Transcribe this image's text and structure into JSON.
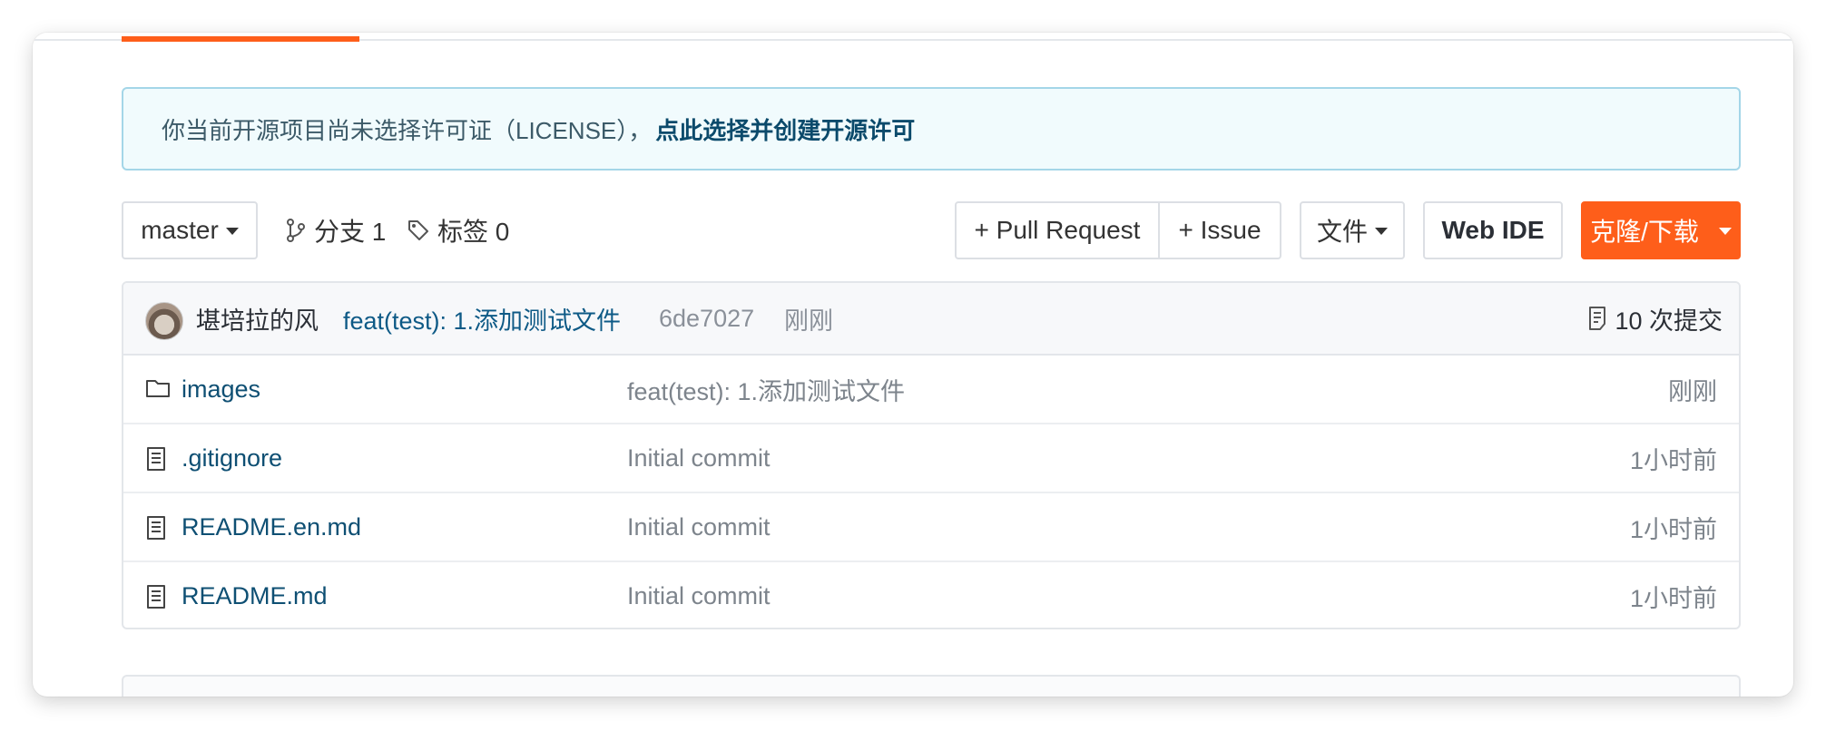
{
  "license_banner": {
    "text": "你当前开源项目尚未选择许可证（LICENSE），",
    "link": "点此选择并创建开源许可"
  },
  "toolbar": {
    "branch_selector": "master",
    "branches_label": "分支 1",
    "tags_label": "标签 0",
    "pull_request_button": "+ Pull Request",
    "issue_button": "+ Issue",
    "file_button": "文件",
    "web_ide_button": "Web IDE",
    "clone_button": "克隆/下载"
  },
  "latest_commit": {
    "author": "堪培拉的风",
    "message": "feat(test): 1.添加测试文件",
    "sha": "6de7027",
    "time": "刚刚",
    "commit_count": "10 次提交"
  },
  "files": [
    {
      "name": "images",
      "type": "folder",
      "commit": "feat(test): 1.添加测试文件",
      "time": "刚刚"
    },
    {
      "name": ".gitignore",
      "type": "file",
      "commit": "Initial commit",
      "time": "1小时前"
    },
    {
      "name": "README.en.md",
      "type": "file",
      "commit": "Initial commit",
      "time": "1小时前"
    },
    {
      "name": "README.md",
      "type": "file",
      "commit": "Initial commit",
      "time": "1小时前"
    }
  ],
  "colors": {
    "accent": "#fe5e1a",
    "link": "#0e4f73",
    "banner_bg": "#f1fbfd",
    "banner_border": "#a4d6e8"
  },
  "icons": {
    "branch": "git-branch-icon",
    "tag": "tag-icon",
    "commits": "commit-list-icon",
    "folder": "folder-icon",
    "file": "file-text-icon"
  }
}
